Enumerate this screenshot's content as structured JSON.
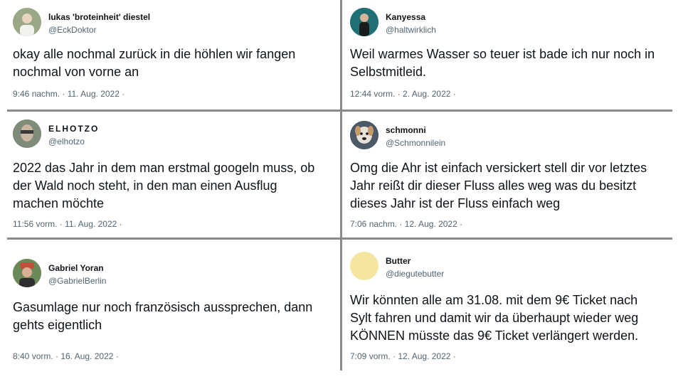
{
  "tweets": [
    {
      "name": "lukas 'broteinheit' diestel",
      "handle": "@EckDoktor",
      "text": "okay alle nochmal zurück in die höhlen wir fangen\nnochmal von vorne an",
      "meta": "9:46 nachm. · 11. Aug. 2022 ·",
      "avatar": "person-avatar",
      "avatar_color": "#7a8a70"
    },
    {
      "name": "Kanyessa",
      "handle": "@haltwirklich",
      "text": "Weil warmes Wasser so teuer ist bade ich nur noch in\nSelbstmitleid.",
      "meta": "12:44 vorm. · 2. Aug. 2022 ·",
      "avatar": "person-avatar",
      "avatar_color": "#1f6f74"
    },
    {
      "name": "ELHOTZO",
      "handle": "@elhotzo",
      "text": "2022 das Jahr in dem man erstmal googeln muss, ob\nder Wald noch steht, in den man einen Ausflug\nmachen  möchte",
      "meta": "11:56 vorm. · 11. Aug. 2022 ·",
      "avatar": "person-avatar",
      "avatar_color": "#8f9d8a"
    },
    {
      "name": "schmonni",
      "handle": "@Schmonnilein",
      "text": "Omg die Ahr ist einfach versickert stell dir vor letztes\nJahr reißt dir dieser Fluss alles weg was du besitzt\ndieses Jahr ist der Fluss einfach weg",
      "meta": "7:06 nachm. · 12. Aug. 2022 ·",
      "avatar": "dog-avatar",
      "avatar_color": "#4b5a66"
    },
    {
      "name": "Gabriel Yoran",
      "handle": "@GabrielBerlin",
      "text": "Gasumlage nur noch französisch aussprechen, dann\ngehts eigentlich",
      "meta": "8:40 vorm. · 16. Aug. 2022 ·",
      "avatar": "person-avatar",
      "avatar_color": "#c0503a"
    },
    {
      "name": "Butter",
      "handle": "@diegutebutter",
      "text": "Wir könnten alle am 31.08. mit dem 9€ Ticket nach\nSylt fahren und damit wir da überhaupt wieder weg\nKÖNNEN müsste das 9€ Ticket verlängert werden.",
      "meta": "7:09 vorm. · 12. Aug. 2022 ·",
      "avatar": "plain-avatar",
      "avatar_color": "#f4e6a1"
    }
  ]
}
